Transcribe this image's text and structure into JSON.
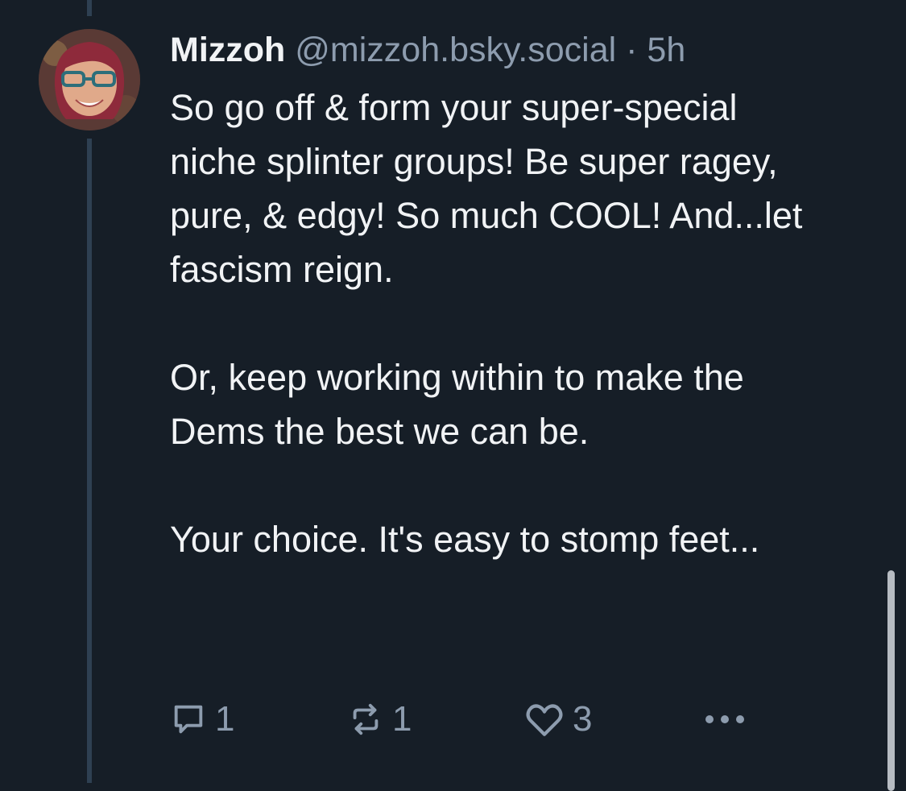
{
  "post": {
    "author": {
      "display_name": "Mizzoh",
      "handle": "@mizzoh.bsky.social"
    },
    "separator": "·",
    "timestamp": "5h",
    "text": "So go off & form your super-special niche splinter groups! Be super ragey, pure, & edgy! So much COOL! And...let fascism reign.\n\nOr, keep working within to make the Dems the best we can be.\n\nYour choice. It's easy to stomp feet...",
    "actions": {
      "reply_count": "1",
      "repost_count": "1",
      "like_count": "3"
    }
  },
  "icons": {
    "reply": "speech-bubble-icon",
    "repost": "repost-arrows-icon",
    "like": "heart-icon",
    "more": "ellipsis-icon"
  },
  "colors": {
    "background": "#161e27",
    "text_primary": "#f1f3f5",
    "text_secondary": "#8d9cae",
    "thread_line": "#2e4052"
  }
}
